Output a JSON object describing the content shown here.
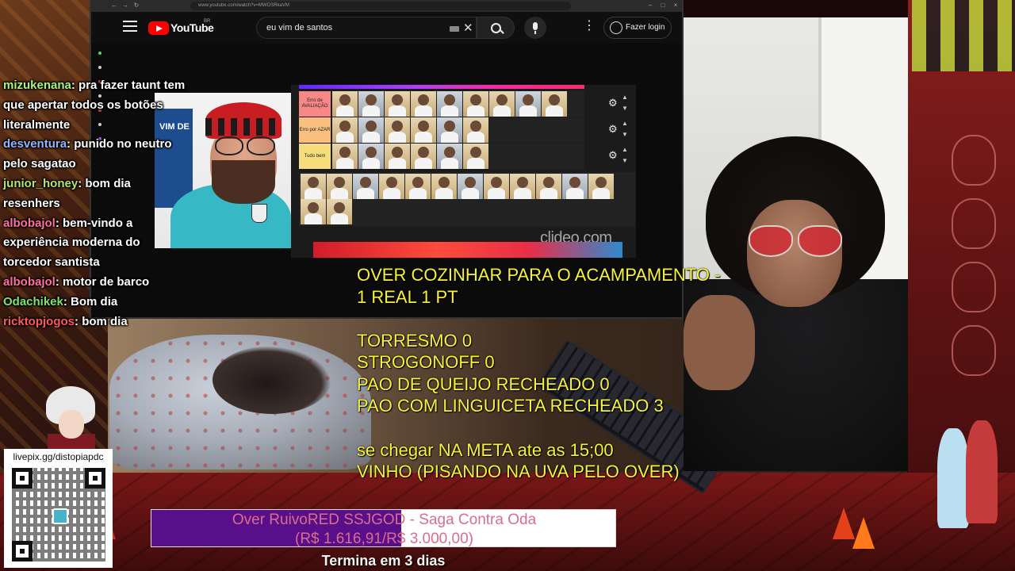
{
  "browser": {
    "url": "www.youtube.com/watch?v=MWOSRkaVM",
    "youtube": {
      "logo_text": "YouTube",
      "country": "BR",
      "search_value": "eu vim de santos",
      "login_label": "Fazer login"
    }
  },
  "tier_list": {
    "rows": [
      {
        "label": "Erro de AVALIAÇÃO",
        "color": "#f78887",
        "item_count": 9
      },
      {
        "label": "Erro por AZAR",
        "color": "#f8bf7e",
        "item_count": 6
      },
      {
        "label": "Tudo bem",
        "color": "#f6dc7a",
        "item_count": 6
      }
    ],
    "pool_item_count": 14,
    "watermark": "clideo.com"
  },
  "cam_left": {
    "sign_text": "VIM DE"
  },
  "chat": [
    {
      "user": "mizukenana",
      "color": "#a6f47f",
      "message": "pra fazer taunt tem"
    },
    {
      "user": "",
      "color": "#ffffff",
      "message": "que apertar todos os botões"
    },
    {
      "user": "",
      "color": "#ffffff",
      "message": "literalmente"
    },
    {
      "user": "desventura",
      "color": "#8fb6ff",
      "message": "punido no neutro"
    },
    {
      "user": "",
      "color": "#ffffff",
      "message": "pelo sagatao"
    },
    {
      "user": "junior_honey",
      "color": "#b7e36a",
      "message": "bom dia"
    },
    {
      "user": "",
      "color": "#ffffff",
      "message": "resenhers"
    },
    {
      "user": "albobajol",
      "color": "#ff6fa0",
      "message": "bem-vindo a"
    },
    {
      "user": "",
      "color": "#ffffff",
      "message": "experiência moderna do"
    },
    {
      "user": "",
      "color": "#ffffff",
      "message": "torcedor santista"
    },
    {
      "user": "albobajol",
      "color": "#ff6fa0",
      "message": "motor de barco"
    },
    {
      "user": "Odachikek",
      "color": "#7fe36d",
      "message": "Bom dia"
    },
    {
      "user": "ricktopjogos",
      "color": "#ff5a5a",
      "message": "bom dia"
    }
  ],
  "overlay": {
    "line1": "OVER COZINHAR PARA O ACAMPAMENTO -",
    "line2": "1 REAL 1 PT",
    "items": [
      "TORRESMO 0",
      "STROGONOFF  0",
      "PAO DE QUEIJO RECHEADO 0",
      "PAO COM LINGUICETA RECHEADO 3"
    ],
    "meta_line1": "se chegar NA META ate as 15;00",
    "meta_line2": "VINHO (PISANDO NA UVA PELO OVER)"
  },
  "qr": {
    "url": "livepix.gg/distopiapdc"
  },
  "goal": {
    "line1": "Over RuivoRED SSJGOD - Saga Contra Oda",
    "line2": "(R$ 1.616,91/R$ 3.000,00)",
    "progress": 0.539,
    "fill_color": "#5a0f8a",
    "footer": "Termina em 3 dias"
  }
}
